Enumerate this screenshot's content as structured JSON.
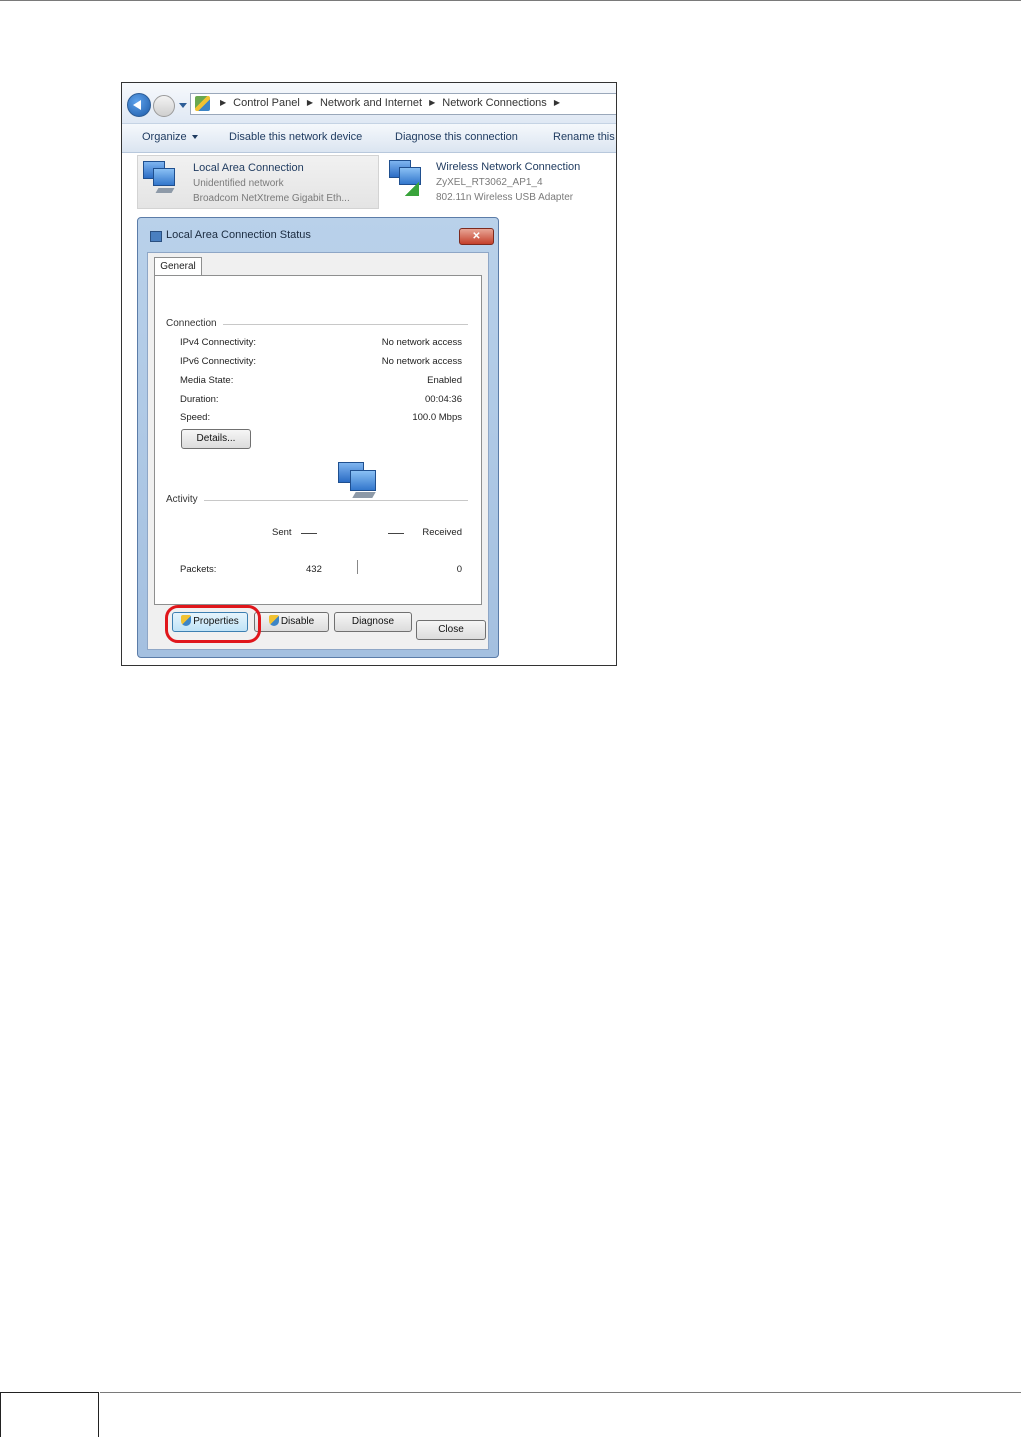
{
  "address_bar": {
    "breadcrumbs": [
      "Control Panel",
      "Network and Internet",
      "Network Connections"
    ]
  },
  "toolbar": {
    "organize": "Organize",
    "disable": "Disable this network device",
    "diagnose": "Diagnose this connection",
    "rename": "Rename this"
  },
  "connections": [
    {
      "name": "Local Area Connection",
      "line1": "Unidentified network",
      "line2": "Broadcom NetXtreme Gigabit Eth..."
    },
    {
      "name": "Wireless Network Connection",
      "line1": "ZyXEL_RT3062_AP1_4",
      "line2": "802.11n Wireless USB Adapter"
    }
  ],
  "dialog": {
    "title": "Local Area Connection Status",
    "close_glyph": "✕",
    "tab": "General",
    "connection": {
      "heading": "Connection",
      "rows": [
        {
          "label": "IPv4 Connectivity:",
          "value": "No network access"
        },
        {
          "label": "IPv6 Connectivity:",
          "value": "No network access"
        },
        {
          "label": "Media State:",
          "value": "Enabled"
        },
        {
          "label": "Duration:",
          "value": "00:04:36"
        },
        {
          "label": "Speed:",
          "value": "100.0 Mbps"
        }
      ],
      "details_button": "Details..."
    },
    "activity": {
      "heading": "Activity",
      "sent": "Sent",
      "received": "Received",
      "packets_label": "Packets:",
      "packets_sent": "432",
      "packets_received": "0"
    },
    "buttons": {
      "properties": "Properties",
      "disable": "Disable",
      "diagnose": "Diagnose",
      "close": "Close"
    }
  },
  "colors": {
    "highlight": "#e0161b",
    "title_bar": "#b9d1ea"
  }
}
